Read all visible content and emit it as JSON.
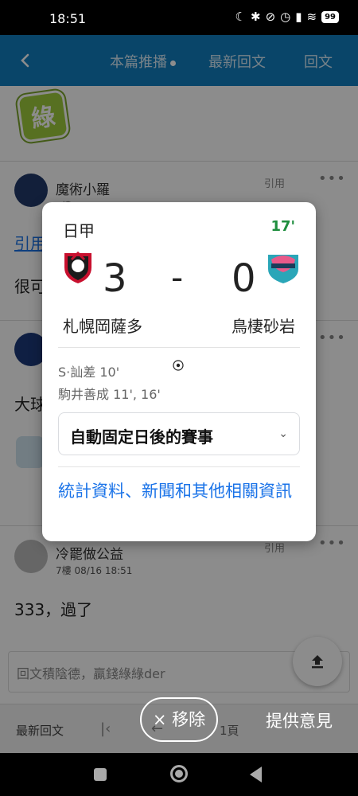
{
  "status_bar": {
    "time": "18:51",
    "battery": "99"
  },
  "app_bar": {
    "tabs": [
      "本篇推播",
      "最新回文",
      "回文"
    ]
  },
  "background": {
    "sticker_text": "綠",
    "posts": [
      {
        "name": "魔術小羅",
        "meta": "5樓 08/16 17:45",
        "quote": "引用",
        "text_fragments": [
          "引用",
          "很可"
        ]
      },
      {
        "name": "",
        "meta": "",
        "quote": "",
        "text_fragments": [
          "大球"
        ]
      },
      {
        "name": "冷罷做公益",
        "meta": "7樓 08/16 18:51",
        "quote": "引用",
        "text": "333，過了"
      }
    ],
    "reply_placeholder": "回文積陰德，贏錢綠綠der"
  },
  "bottom_bar": {
    "latest": "最新回文",
    "page_label": "1頁"
  },
  "overlay_actions": {
    "remove_label": "× 移除",
    "feedback_label": "提供意見"
  },
  "score_card": {
    "league": "日甲",
    "minute": "17'",
    "home_team": "札幌岡薩多",
    "away_team": "鳥棲砂岩",
    "home_score": "3",
    "separator": "-",
    "away_score": "0",
    "scorers": [
      "S·訕差 10'",
      "駒井善成 11', 16'"
    ],
    "auto_pin_label": "自動固定日後的賽事",
    "more_link": "統計資料、新聞和其他相關資訊",
    "colors": {
      "minute": "#1e8e3e",
      "link": "#1a73e8",
      "home_primary": "#c8102e",
      "away_primary": "#2aa6b8"
    }
  }
}
